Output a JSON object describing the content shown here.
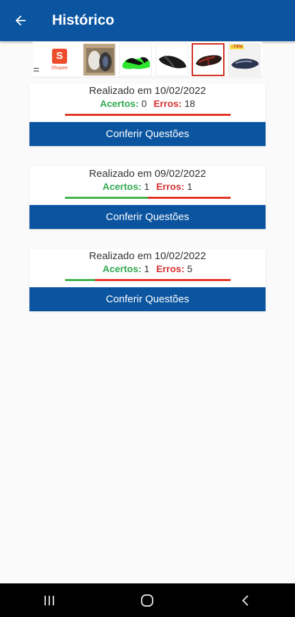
{
  "appbar": {
    "title": "Histórico",
    "back_icon": "arrow-left-icon",
    "color": "#0b55a0"
  },
  "ad": {
    "brand": "Shopee",
    "brand_letter": "S",
    "discount_badge": "-74%"
  },
  "history": [
    {
      "date_label": "Realizado em 10/02/2022",
      "acertos_label": "Acertos:",
      "acertos": "0",
      "erros_label": "Erros:",
      "erros": "18",
      "button_label": "Conferir Questões"
    },
    {
      "date_label": "Realizado em 09/02/2022",
      "acertos_label": "Acertos:",
      "acertos": "1",
      "erros_label": "Erros:",
      "erros": "1",
      "button_label": "Conferir Questões"
    },
    {
      "date_label": "Realizado em 10/02/2022",
      "acertos_label": "Acertos:",
      "acertos": "1",
      "erros_label": "Erros:",
      "erros": "5",
      "button_label": "Conferir Questões"
    }
  ],
  "colors": {
    "primary": "#0b55a0",
    "success": "#3cb24b",
    "error": "#e53125"
  },
  "navbar": {
    "recents_icon": "recents-icon",
    "home_icon": "home-icon",
    "back_icon": "back-chevron-icon"
  }
}
